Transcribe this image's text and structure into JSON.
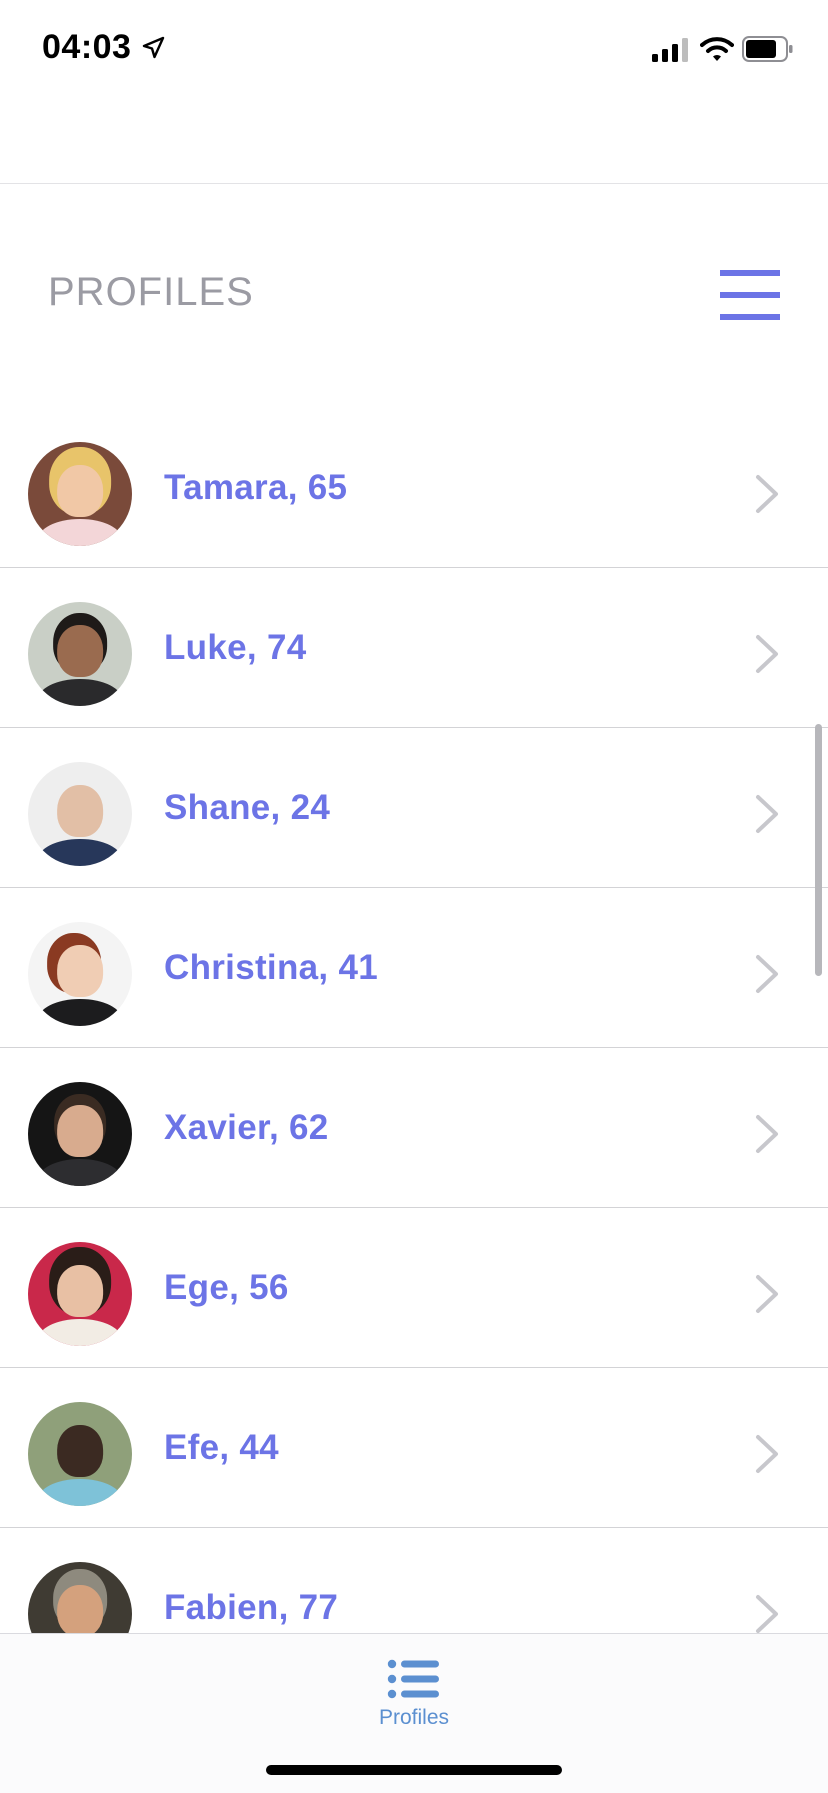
{
  "status_bar": {
    "time": "04:03",
    "icons": [
      "location-arrow-icon",
      "cellular-signal-icon",
      "wifi-icon",
      "battery-icon"
    ]
  },
  "header": {
    "title": "PROFILES",
    "menu_icon": "hamburger-menu-icon"
  },
  "colors": {
    "accent": "#6c74e6",
    "title_gray": "#9b9ba3",
    "chevron": "#c7c7cc",
    "tab_blue": "#5b8fd0"
  },
  "profiles": [
    {
      "label": "Tamara, 65"
    },
    {
      "label": "Luke, 74"
    },
    {
      "label": "Shane, 24"
    },
    {
      "label": "Christina, 41"
    },
    {
      "label": "Xavier, 62"
    },
    {
      "label": "Ege, 56"
    },
    {
      "label": "Efe, 44"
    },
    {
      "label": "Fabien, 77"
    }
  ],
  "tab_bar": {
    "items": [
      {
        "label": "Profiles",
        "icon": "list-icon"
      }
    ]
  }
}
